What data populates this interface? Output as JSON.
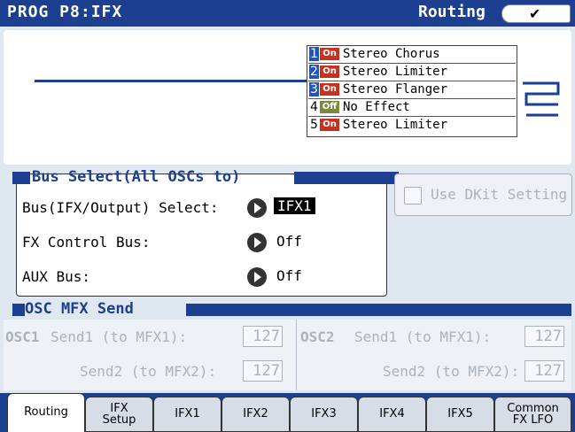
{
  "header": {
    "title": "PROG P8:IFX",
    "page_name": "Routing",
    "menu_icon": "chevron-down-icon"
  },
  "ifx_list": [
    {
      "num": "1",
      "state": "On",
      "name": "Stereo Chorus",
      "selected": true
    },
    {
      "num": "2",
      "state": "On",
      "name": "Stereo Limiter",
      "selected": false
    },
    {
      "num": "3",
      "state": "On",
      "name": "Stereo Flanger",
      "selected": false
    },
    {
      "num": "4",
      "state": "Off",
      "name": "No Effect",
      "selected": false
    },
    {
      "num": "5",
      "state": "On",
      "name": "Stereo Limiter",
      "selected": false
    }
  ],
  "bus_select": {
    "section_title": "Bus Select(All OSCs to)",
    "bus_label": "Bus(IFX/Output) Select:",
    "bus_value": "IFX1",
    "fx_control_label": "FX Control Bus:",
    "fx_control_value": "Off",
    "aux_label": "AUX Bus:",
    "aux_value": "Off"
  },
  "use_dkit": {
    "label": "Use DKit Setting"
  },
  "mfx_send": {
    "section_title": "OSC MFX Send",
    "osc1": {
      "label": "OSC1",
      "send1_label": "Send1 (to MFX1):",
      "send1_value": "127",
      "send2_label": "Send2 (to MFX2):",
      "send2_value": "127"
    },
    "osc2": {
      "label": "OSC2",
      "send1_label": "Send1 (to MFX1):",
      "send1_value": "127",
      "send2_label": "Send2 (to MFX2):",
      "send2_value": "127"
    }
  },
  "tabs": [
    {
      "line1": "Routing",
      "line2": ""
    },
    {
      "line1": "IFX",
      "line2": "Setup"
    },
    {
      "line1": "IFX1",
      "line2": ""
    },
    {
      "line1": "IFX2",
      "line2": ""
    },
    {
      "line1": "IFX3",
      "line2": ""
    },
    {
      "line1": "IFX4",
      "line2": ""
    },
    {
      "line1": "IFX5",
      "line2": ""
    },
    {
      "line1": "Common",
      "line2": "FX LFO"
    }
  ],
  "colors": {
    "accent": "#1d3f8f",
    "on": "#c8311e",
    "off": "#7a8a3a"
  }
}
